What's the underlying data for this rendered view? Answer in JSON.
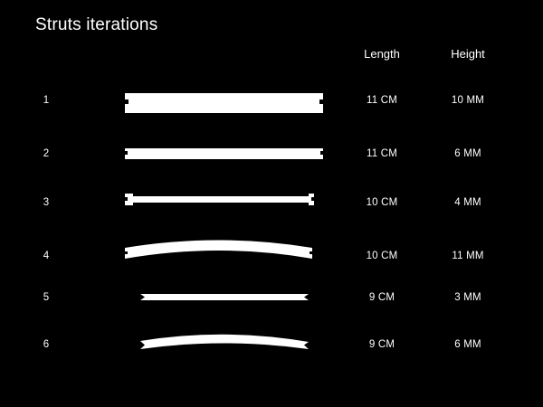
{
  "title": "Struts iterations",
  "headers": {
    "length": "Length",
    "height": "Height"
  },
  "colors": {
    "background": "#000000",
    "foreground": "#ffffff"
  },
  "rows": [
    {
      "index": "1",
      "length": "11 CM",
      "height": "10 MM",
      "shape": "notched-thick-bar"
    },
    {
      "index": "2",
      "length": "11 CM",
      "height": "6 MM",
      "shape": "notched-medium-bar"
    },
    {
      "index": "3",
      "length": "10 CM",
      "height": "4 MM",
      "shape": "notched-thin-bar"
    },
    {
      "index": "4",
      "length": "10 CM",
      "height": "11 MM",
      "shape": "notched-arched-bar"
    },
    {
      "index": "5",
      "length": "9 CM",
      "height": "3 MM",
      "shape": "flat-thin-strip-v-ends"
    },
    {
      "index": "6",
      "length": "9 CM",
      "height": "6 MM",
      "shape": "curved-strip-v-ends"
    }
  ]
}
